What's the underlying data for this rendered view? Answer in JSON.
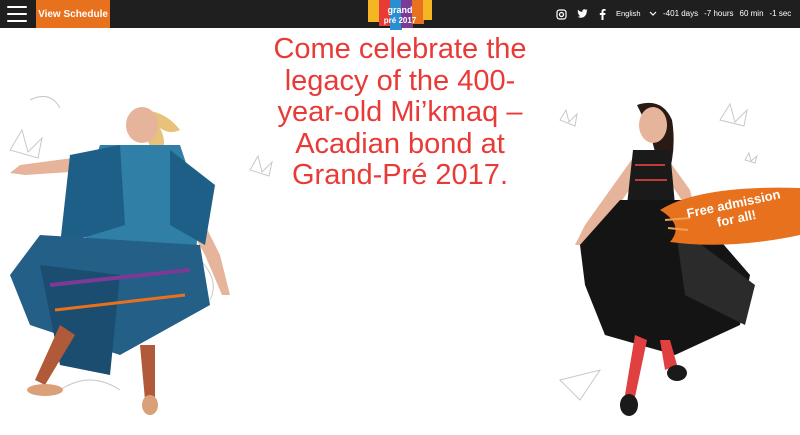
{
  "header": {
    "schedule_label": "View Schedule",
    "logo_text_line1": "grand",
    "logo_text_line2": "pré 2017",
    "language": "English",
    "countdown": {
      "days": "-401 days",
      "hours": "-7 hours",
      "minutes": "60 min",
      "seconds": "-1 sec"
    }
  },
  "hero": {
    "headline": "Come celebrate the legacy of the 400-year-old Mi’kmaq – Acadian bond at Grand-Pré 2017.",
    "badge_line1": "Free admission",
    "badge_line2": "for all!"
  },
  "colors": {
    "accent_orange": "#e8711d",
    "headline_red": "#e83a37",
    "topbar": "#1f1f1f"
  },
  "icons": [
    "menu-icon",
    "instagram-icon",
    "twitter-icon",
    "facebook-icon",
    "chevron-down-icon"
  ]
}
